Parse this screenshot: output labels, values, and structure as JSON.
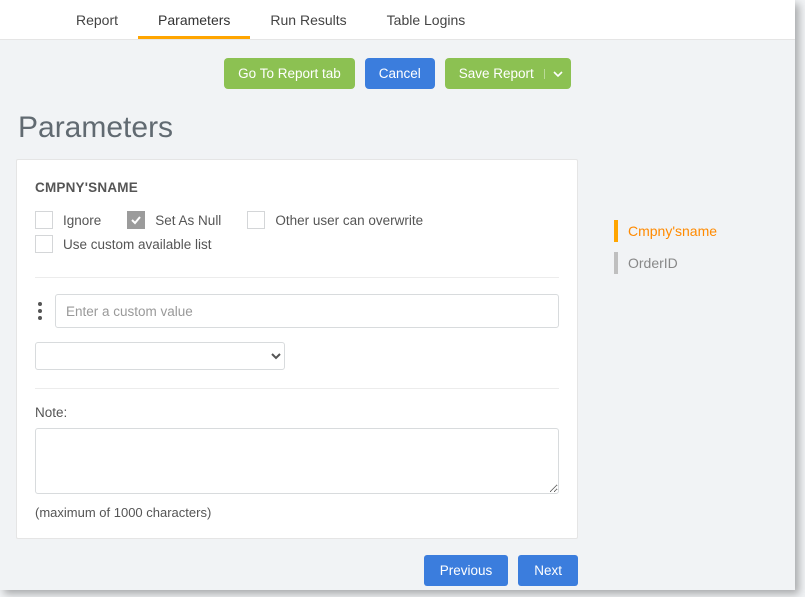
{
  "tabs": {
    "items": [
      {
        "label": "Report",
        "active": false
      },
      {
        "label": "Parameters",
        "active": true
      },
      {
        "label": "Run Results",
        "active": false
      },
      {
        "label": "Table Logins",
        "active": false
      }
    ]
  },
  "toolbar": {
    "go_to_report": "Go To Report tab",
    "cancel": "Cancel",
    "save_report": "Save Report"
  },
  "page_title": "Parameters",
  "param": {
    "name": "CMPNY'SNAME",
    "checks": {
      "ignore": {
        "label": "Ignore",
        "checked": false
      },
      "set_as_null": {
        "label": "Set As Null",
        "checked": true
      },
      "other_overwrite": {
        "label": "Other user can overwrite",
        "checked": false
      },
      "custom_list": {
        "label": "Use custom available list",
        "checked": false
      }
    },
    "custom_value_placeholder": "Enter a custom value",
    "select_value": "",
    "note_label": "Note:",
    "note_value": "",
    "note_hint": "(maximum of 1000 characters)"
  },
  "side": {
    "items": [
      {
        "label": "Cmpny'sname",
        "active": true
      },
      {
        "label": "OrderID",
        "active": false
      }
    ]
  },
  "footer": {
    "previous": "Previous",
    "next": "Next"
  }
}
